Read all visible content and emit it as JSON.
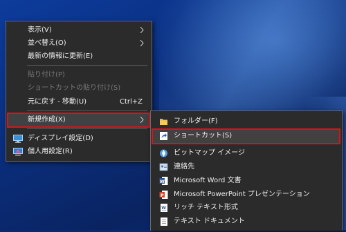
{
  "context_menu": {
    "items": [
      {
        "label": "表示(V)"
      },
      {
        "label": "並べ替え(O)"
      },
      {
        "label": "最新の情報に更新(E)"
      },
      {
        "label": "貼り付け(P)"
      },
      {
        "label": "ショートカットの貼り付け(S)"
      },
      {
        "label": "元に戻す - 移動(U)",
        "shortcut": "Ctrl+Z"
      },
      {
        "label": "新規作成(X)"
      },
      {
        "label": "ディスプレイ設定(D)",
        "icon": "display-settings-icon"
      },
      {
        "label": "個人用設定(R)",
        "icon": "personalize-icon"
      }
    ]
  },
  "new_submenu": {
    "items": [
      {
        "label": "フォルダー(F)",
        "icon": "folder-icon"
      },
      {
        "label": "ショートカット(S)",
        "icon": "shortcut-icon"
      },
      {
        "label": "ビットマップ イメージ",
        "icon": "bitmap-icon"
      },
      {
        "label": "連絡先",
        "icon": "contact-icon"
      },
      {
        "label": "Microsoft Word 文書",
        "icon": "word-icon"
      },
      {
        "label": "Microsoft PowerPoint プレゼンテーション",
        "icon": "powerpoint-icon"
      },
      {
        "label": "リッチ テキスト形式",
        "icon": "rtf-icon"
      },
      {
        "label": "テキスト ドキュメント",
        "icon": "text-document-icon"
      }
    ]
  },
  "colors": {
    "menu_bg": "#2b2b2b",
    "highlight_border": "#d8141a",
    "disabled_text": "#777777"
  }
}
